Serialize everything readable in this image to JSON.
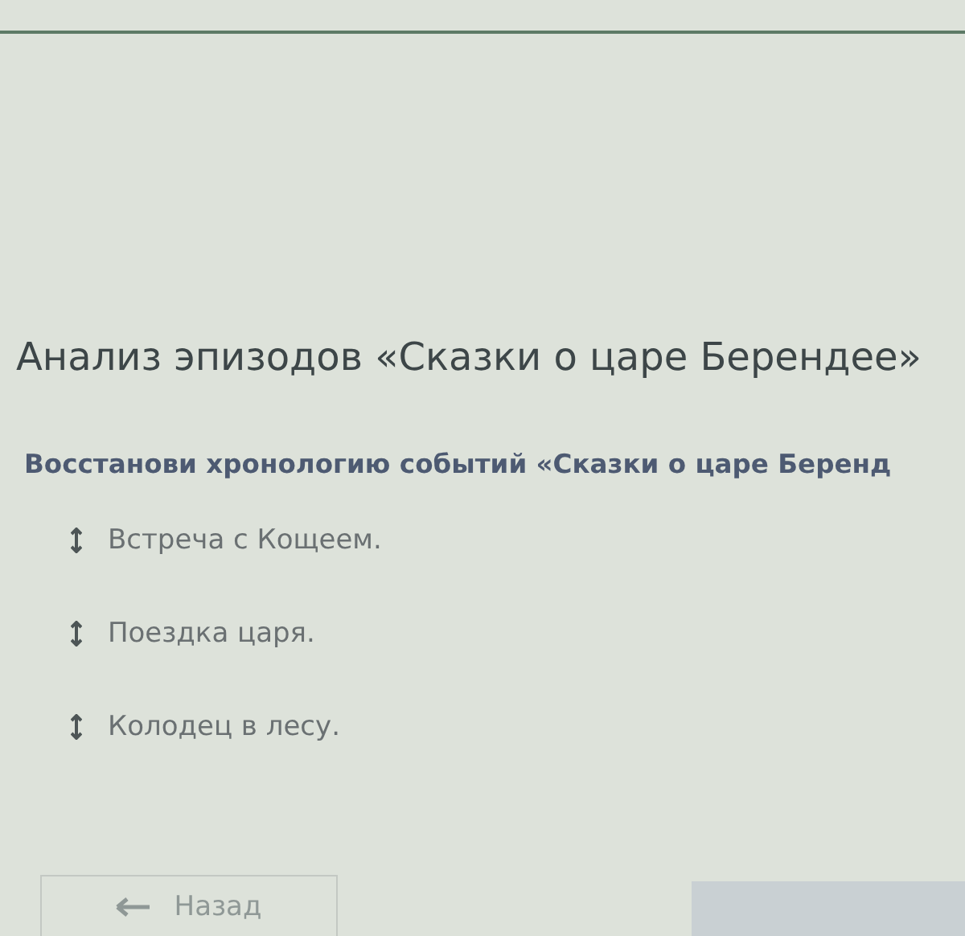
{
  "title": "Анализ эпизодов «Сказки о царе Берендее»",
  "question": "Восстанови хронологию событий «Сказки о царе Беренд",
  "items": [
    {
      "text": "Встреча с Кощеем."
    },
    {
      "text": "Поездка царя."
    },
    {
      "text": "Колодец в лесу."
    }
  ],
  "back_button": {
    "label": "Назад",
    "disabled": true
  }
}
